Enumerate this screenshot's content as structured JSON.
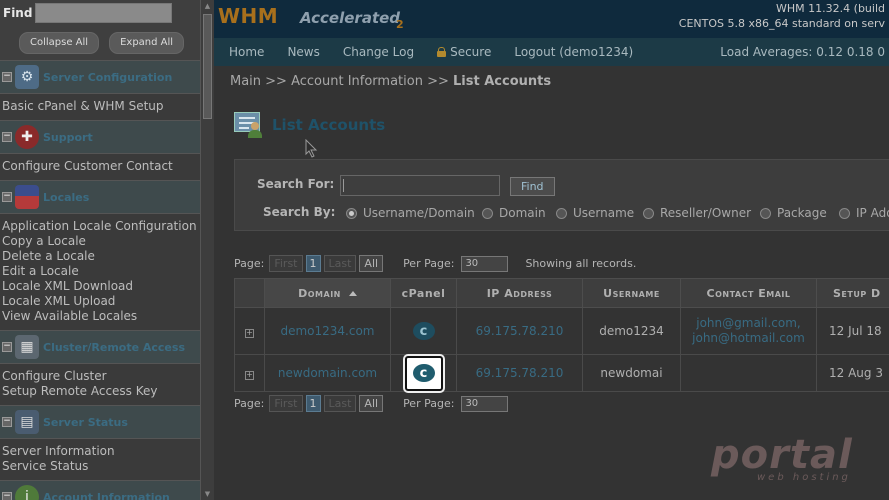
{
  "sidebar": {
    "find_label": "Find",
    "collapse_all": "Collapse All",
    "expand_all": "Expand All",
    "sections": [
      {
        "title": "Server Configuration",
        "icon": "server-config-icon",
        "links": [
          "Basic cPanel & WHM Setup"
        ]
      },
      {
        "title": "Support",
        "icon": "lifebuoy-icon",
        "links": [
          "Configure Customer Contact"
        ]
      },
      {
        "title": "Locales",
        "icon": "flag-icon",
        "links": [
          "Application Locale Configuration",
          "Copy a Locale",
          "Delete a Locale",
          "Edit a Locale",
          "Locale XML Download",
          "Locale XML Upload",
          "View Available Locales"
        ]
      },
      {
        "title": "Cluster/Remote Access",
        "icon": "cluster-icon",
        "links": [
          "Configure Cluster",
          "Setup Remote Access Key"
        ]
      },
      {
        "title": "Server Status",
        "icon": "server-status-icon",
        "links": [
          "Server Information",
          "Service Status"
        ]
      },
      {
        "title": "Account Information",
        "icon": "info-icon",
        "links": []
      }
    ]
  },
  "header": {
    "logo_whm": "WHM",
    "logo_accelerated": "Accelerated",
    "logo_sub": "2",
    "version": "WHM 11.32.4 (build",
    "os": "CENTOS 5.8 x86_64 standard on serv"
  },
  "nav": {
    "items": [
      "Home",
      "News",
      "Change Log",
      "Secure",
      "Logout (demo1234)"
    ],
    "load": "Load Averages: 0.12 0.18 0"
  },
  "breadcrumb": {
    "path": "Main >> Account Information >> ",
    "current": "List Accounts"
  },
  "page_title": "List Accounts",
  "search": {
    "search_for_label": "Search For:",
    "find_button": "Find",
    "search_by_label": "Search By:",
    "options": [
      "Username/Domain",
      "Domain",
      "Username",
      "Reseller/Owner",
      "Package",
      "IP Add"
    ],
    "selected": 0
  },
  "pager": {
    "page_label": "Page:",
    "first": "First",
    "current_page": "1",
    "last": "Last",
    "all": "All",
    "per_page_label": "Per Page:",
    "per_page": "30",
    "showing": "Showing all records."
  },
  "table": {
    "headers": [
      "Domain",
      "cPanel",
      "IP Address",
      "Username",
      "Contact Email",
      "Setup D"
    ],
    "rows": [
      {
        "domain": "demo1234.com",
        "ip": "69.175.78.210",
        "username": "demo1234",
        "email1": "john@gmail.com,",
        "email2": "john@hotmail.com",
        "setup": "12 Jul 18"
      },
      {
        "domain": "newdomain.com",
        "ip": "69.175.78.210",
        "username": "newdomai",
        "email1": "",
        "email2": "",
        "setup": "12 Aug 3"
      }
    ]
  },
  "watermark": {
    "brand": "portal",
    "sub": "web hosting"
  }
}
